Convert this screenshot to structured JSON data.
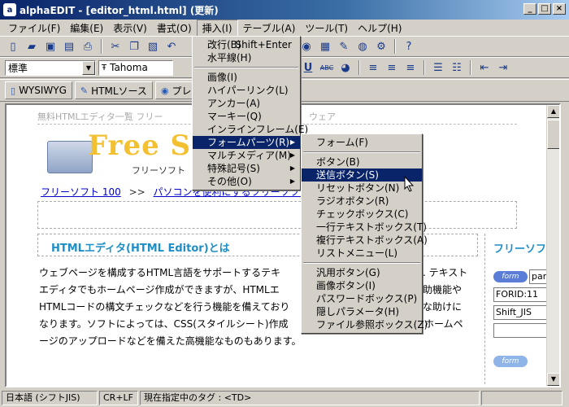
{
  "window": {
    "title": "alphaEDIT - [editor_html.html] (更新)"
  },
  "menubar": {
    "items": [
      "ファイル(F)",
      "編集(E)",
      "表示(V)",
      "書式(O)",
      "挿入(I)",
      "テーブル(A)",
      "ツール(T)",
      "ヘルプ(H)"
    ]
  },
  "format_toolbar": {
    "style_value": "標準",
    "font_value": "Tahoma"
  },
  "mode_toolbar": {
    "wysiwyg": "WYSIWYG",
    "html_source": "HTMLソース",
    "preview": "プレビ"
  },
  "document": {
    "crumb": "無料HTMLエディタ一覧  フリー",
    "crumb_tail": "ウェア",
    "logo_text": "Free Sc",
    "logo_sub": "フリーソフト",
    "link1": "フリーソフト 100",
    "link_sep": ">>",
    "link2": "パソコンを便利にするフリーソフト",
    "heading": "HTMLエディタ(HTML Editor)とは",
    "paragraph_lines": [
      "ウェブページを構成するHTML言語をサポートするテキ",
      "エディタでもホームページ作成ができますが、HTMLエ",
      "HTMLコードの構文チェックなどを行う機能を備えており",
      "なります。ソフトによっては、CSS(スタイルシート)作成",
      "ージのアップロードなどを備えた高機能なものもあります。"
    ],
    "paragraph_right_lines": [
      ". テキスト",
      "助機能や",
      "な助けに",
      "るホームペ"
    ],
    "right_heading": "フリーソフ",
    "form_badge": "form",
    "input1": "part",
    "input2": "FORID:11",
    "input3": "Shift_JIS",
    "form_badge2": "form"
  },
  "statusbar": {
    "encoding": "日本語 (シフトJIS)",
    "newline": "CR+LF",
    "tag": "現在指定中のタグ : <TD>"
  },
  "insert_menu": {
    "items": [
      {
        "label": "改行(B)",
        "shortcut": "Shift+Enter"
      },
      {
        "label": "水平線(H)"
      },
      {
        "divider": true
      },
      {
        "label": "画像(I)"
      },
      {
        "label": "ハイパーリンク(L)"
      },
      {
        "label": "アンカー(A)"
      },
      {
        "label": "マーキー(Q)"
      },
      {
        "label": "インラインフレーム(E)"
      },
      {
        "label": "フォームパーツ(R)",
        "submenu": true,
        "highlighted": true
      },
      {
        "label": "マルチメディア(M)",
        "submenu": true
      },
      {
        "label": "特殊記号(S)",
        "submenu": true
      },
      {
        "label": "その他(O)",
        "submenu": true
      }
    ]
  },
  "form_parts_menu": {
    "items": [
      {
        "label": "フォーム(F)"
      },
      {
        "divider": true
      },
      {
        "label": "ボタン(B)"
      },
      {
        "label": "送信ボタン(S)",
        "highlighted": true
      },
      {
        "label": "リセットボタン(N)"
      },
      {
        "label": "ラジオボタン(R)"
      },
      {
        "label": "チェックボックス(C)"
      },
      {
        "label": "一行テキストボックス(T)"
      },
      {
        "label": "複行テキストボックス(A)"
      },
      {
        "label": "リストメニュー(L)"
      },
      {
        "divider": true
      },
      {
        "label": "汎用ボタン(G)"
      },
      {
        "label": "画像ボタン(I)"
      },
      {
        "label": "パスワードボックス(P)"
      },
      {
        "label": "隠しパラメータ(H)"
      },
      {
        "label": "ファイル参照ボックス(Z)"
      }
    ]
  },
  "colors": {
    "title_bar": "#0a246a",
    "menu_highlight": "#0a246a",
    "heading_blue": "#1e8ec8",
    "link_blue": "#0000cc"
  }
}
